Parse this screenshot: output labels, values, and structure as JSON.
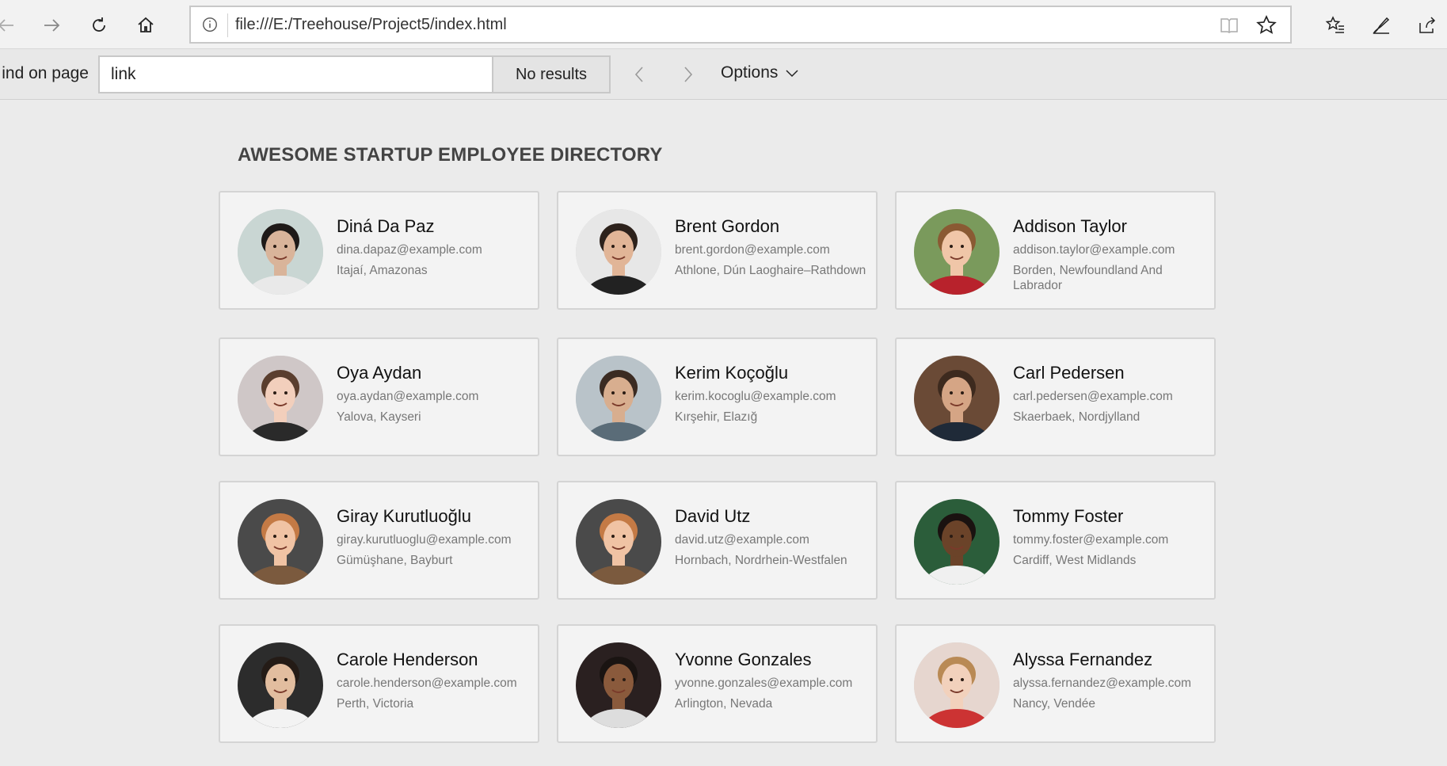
{
  "browser": {
    "url": "file:///E:/Treehouse/Project5/index.html"
  },
  "findbar": {
    "label": "ind on page",
    "query": "link",
    "results": "No results",
    "options_label": "Options"
  },
  "page": {
    "title": "AWESOME STARTUP EMPLOYEE DIRECTORY"
  },
  "employees": [
    {
      "name": "Diná Da Paz",
      "email": "dina.dapaz@example.com",
      "location": "Itajaí, Amazonas"
    },
    {
      "name": "Brent Gordon",
      "email": "brent.gordon@example.com",
      "location": "Athlone, Dún Laoghaire–Rathdown"
    },
    {
      "name": "Addison Taylor",
      "email": "addison.taylor@example.com",
      "location": "Borden, Newfoundland And Labrador"
    },
    {
      "name": "Oya Aydan",
      "email": "oya.aydan@example.com",
      "location": "Yalova, Kayseri"
    },
    {
      "name": "Kerim Koçoğlu",
      "email": "kerim.kocoglu@example.com",
      "location": "Kırşehir, Elazığ"
    },
    {
      "name": "Carl Pedersen",
      "email": "carl.pedersen@example.com",
      "location": "Skaerbaek, Nordjylland"
    },
    {
      "name": "Giray Kurutluoğlu",
      "email": "giray.kurutluoglu@example.com",
      "location": "Gümüşhane, Bayburt"
    },
    {
      "name": "David Utz",
      "email": "david.utz@example.com",
      "location": "Hornbach, Nordrhein-Westfalen"
    },
    {
      "name": "Tommy Foster",
      "email": "tommy.foster@example.com",
      "location": "Cardiff, West Midlands"
    },
    {
      "name": "Carole Henderson",
      "email": "carole.henderson@example.com",
      "location": "Perth, Victoria"
    },
    {
      "name": "Yvonne Gonzales",
      "email": "yvonne.gonzales@example.com",
      "location": "Arlington, Nevada"
    },
    {
      "name": "Alyssa Fernandez",
      "email": "alyssa.fernandez@example.com",
      "location": "Nancy, Vendée"
    }
  ]
}
